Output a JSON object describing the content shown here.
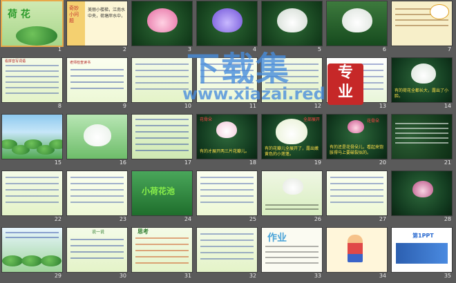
{
  "watermark": {
    "main": "下载集",
    "url": "www.xiazai.red",
    "badge": "专\n业"
  },
  "slides": [
    {
      "n": "1",
      "title": "荷 花"
    },
    {
      "n": "2",
      "title": "美丽小楼梯，江南水中央，荷塘岸水中，"
    },
    {
      "n": "3"
    },
    {
      "n": "4"
    },
    {
      "n": "5"
    },
    {
      "n": "6"
    },
    {
      "n": "7"
    },
    {
      "n": "8"
    },
    {
      "n": "9"
    },
    {
      "n": "10"
    },
    {
      "n": "11"
    },
    {
      "n": "12"
    },
    {
      "n": "13"
    },
    {
      "n": "14"
    },
    {
      "n": "15"
    },
    {
      "n": "16"
    },
    {
      "n": "17"
    },
    {
      "n": "18"
    },
    {
      "n": "19"
    },
    {
      "n": "20"
    },
    {
      "n": "21"
    },
    {
      "n": "22"
    },
    {
      "n": "23"
    },
    {
      "n": "24"
    },
    {
      "n": "25"
    },
    {
      "n": "26"
    },
    {
      "n": "27"
    },
    {
      "n": "28"
    },
    {
      "n": "29"
    },
    {
      "n": "30"
    },
    {
      "n": "31"
    },
    {
      "n": "32"
    },
    {
      "n": "33"
    },
    {
      "n": "34"
    },
    {
      "n": "35"
    }
  ],
  "captions": {
    "s2_side": "奇妙小问题",
    "s8_title": "看拼音写词语",
    "s9_title": "老师检查读书",
    "s14_cap": "有的荷花全都长大，露出了小脸。",
    "s18_tag": "花骨朵",
    "s18_cap": "有的才展开两三片花瓣儿。",
    "s19_tag": "全部展开",
    "s19_cap": "有的花瓣儿全展开了，露出嫩黄色的小莲蓬。",
    "s20_tag": "花骨朵",
    "s20_cap": "有的还是花骨朵儿，看起来饱胀得马上要破裂似的。",
    "s24_title": "小荷花池",
    "s30_tag": "说一说",
    "s31_tag": "思考",
    "s33_title": "作业",
    "s35_logo": "第1PPT"
  }
}
